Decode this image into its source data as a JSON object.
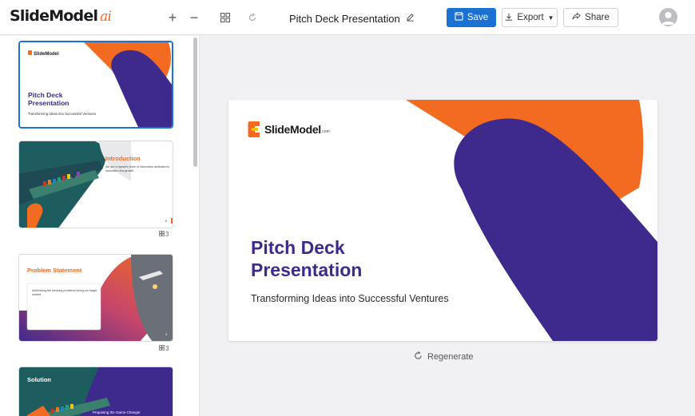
{
  "app": {
    "logo_main": "SlideModel",
    "logo_suffix": "ai",
    "doc_title": "Pitch Deck Presentation"
  },
  "toolbar": {
    "save_label": "Save",
    "export_label": "Export",
    "share_label": "Share"
  },
  "colors": {
    "accent": "#1c72d3",
    "brand_orange": "#f26b21",
    "brand_purple": "#3e2a8c"
  },
  "slides": [
    {
      "title": "Pitch Deck\nPresentation",
      "subtitle": "Transforming Ideas into Successful Ventures",
      "brand": "SlideModel"
    },
    {
      "title": "Introduction",
      "body": "We are a dynamic team of visionaries dedicated to innovation and growth.",
      "page": "2",
      "badge": "3"
    },
    {
      "title": "Problem Statement",
      "body": "Addressing the pressing problems facing our target market.",
      "page": "3",
      "badge": "3"
    },
    {
      "title": "Solution",
      "body": "Proposing the Game Changer"
    }
  ],
  "main_slide": {
    "brand": "SlideModel",
    "brand_suffix": ".com",
    "title_line1": "Pitch Deck",
    "title_line2": "Presentation",
    "subtitle": "Transforming Ideas into Successful Ventures"
  },
  "regenerate_label": "Regenerate"
}
